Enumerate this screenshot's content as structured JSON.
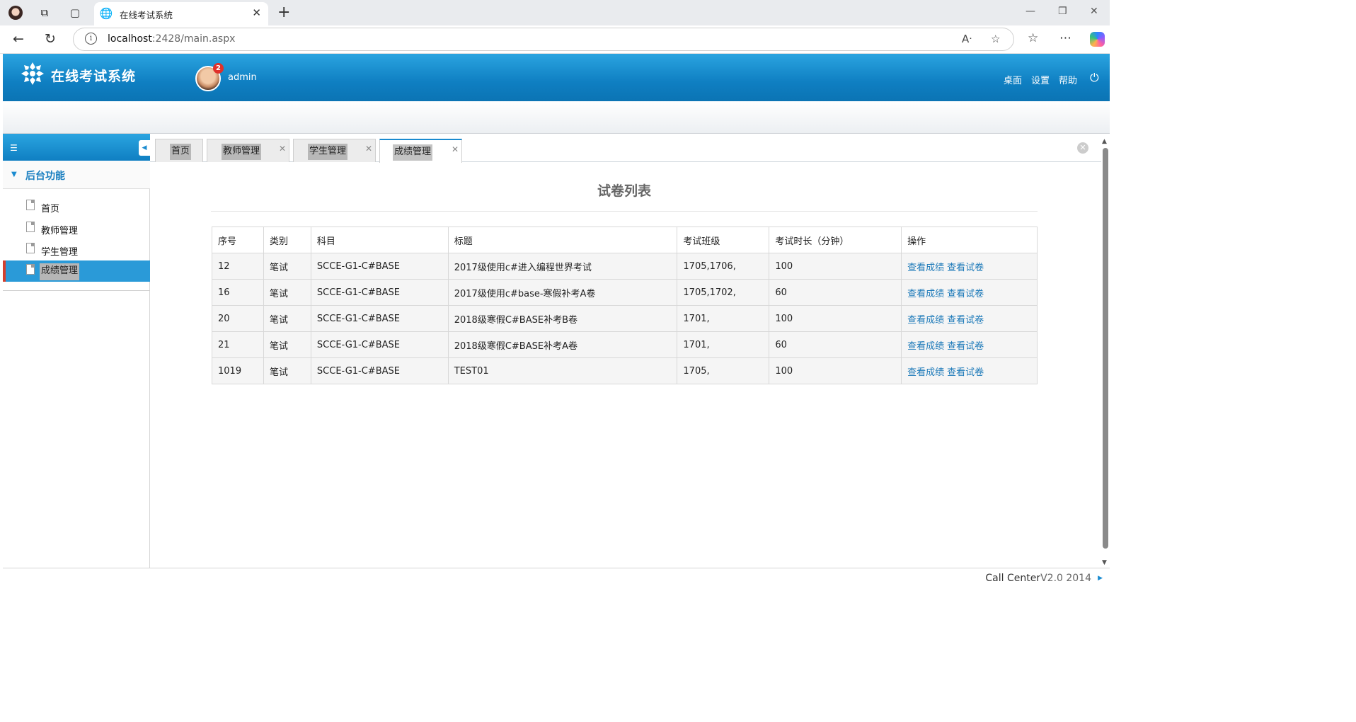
{
  "browser": {
    "tab_title": "在线考试系统",
    "url_host": "localhost",
    "url_path": ":2428/main.aspx"
  },
  "header": {
    "app_title": "在线考试系统",
    "username": "admin",
    "notification_count": "2",
    "nav": [
      "桌面",
      "设置",
      "帮助"
    ]
  },
  "sidebar": {
    "section_title": "后台功能",
    "items": [
      {
        "label": "首页"
      },
      {
        "label": "教师管理"
      },
      {
        "label": "学生管理"
      },
      {
        "label": "成绩管理"
      }
    ]
  },
  "tabs": [
    {
      "label": "首页"
    },
    {
      "label": "教师管理"
    },
    {
      "label": "学生管理"
    },
    {
      "label": "成绩管理"
    }
  ],
  "page": {
    "title": "试卷列表",
    "columns": [
      "序号",
      "类别",
      "科目",
      "标题",
      "考试班级",
      "考试时长（分钟）",
      "操作"
    ],
    "rows": [
      {
        "id": "12",
        "type": "笔试",
        "subject": "SCCE-G1-C#BASE",
        "title": "2017级使用c#进入编程世界考试",
        "classes": "1705,1706,",
        "duration": "100"
      },
      {
        "id": "16",
        "type": "笔试",
        "subject": "SCCE-G1-C#BASE",
        "title": "2017级使用c#base-寒假补考A卷",
        "classes": "1705,1702,",
        "duration": "60"
      },
      {
        "id": "20",
        "type": "笔试",
        "subject": "SCCE-G1-C#BASE",
        "title": "2018级寒假C#BASE补考B卷",
        "classes": "1701,",
        "duration": "100"
      },
      {
        "id": "21",
        "type": "笔试",
        "subject": "SCCE-G1-C#BASE",
        "title": "2018级寒假C#BASE补考A卷",
        "classes": "1701,",
        "duration": "60"
      },
      {
        "id": "1019",
        "type": "笔试",
        "subject": "SCCE-G1-C#BASE",
        "title": "TEST01",
        "classes": "1705,",
        "duration": "100"
      }
    ],
    "action_view_score": "查看成绩",
    "action_view_paper": "查看试卷"
  },
  "footer": {
    "product": "Call Center",
    "version": "V2.0 2014"
  }
}
